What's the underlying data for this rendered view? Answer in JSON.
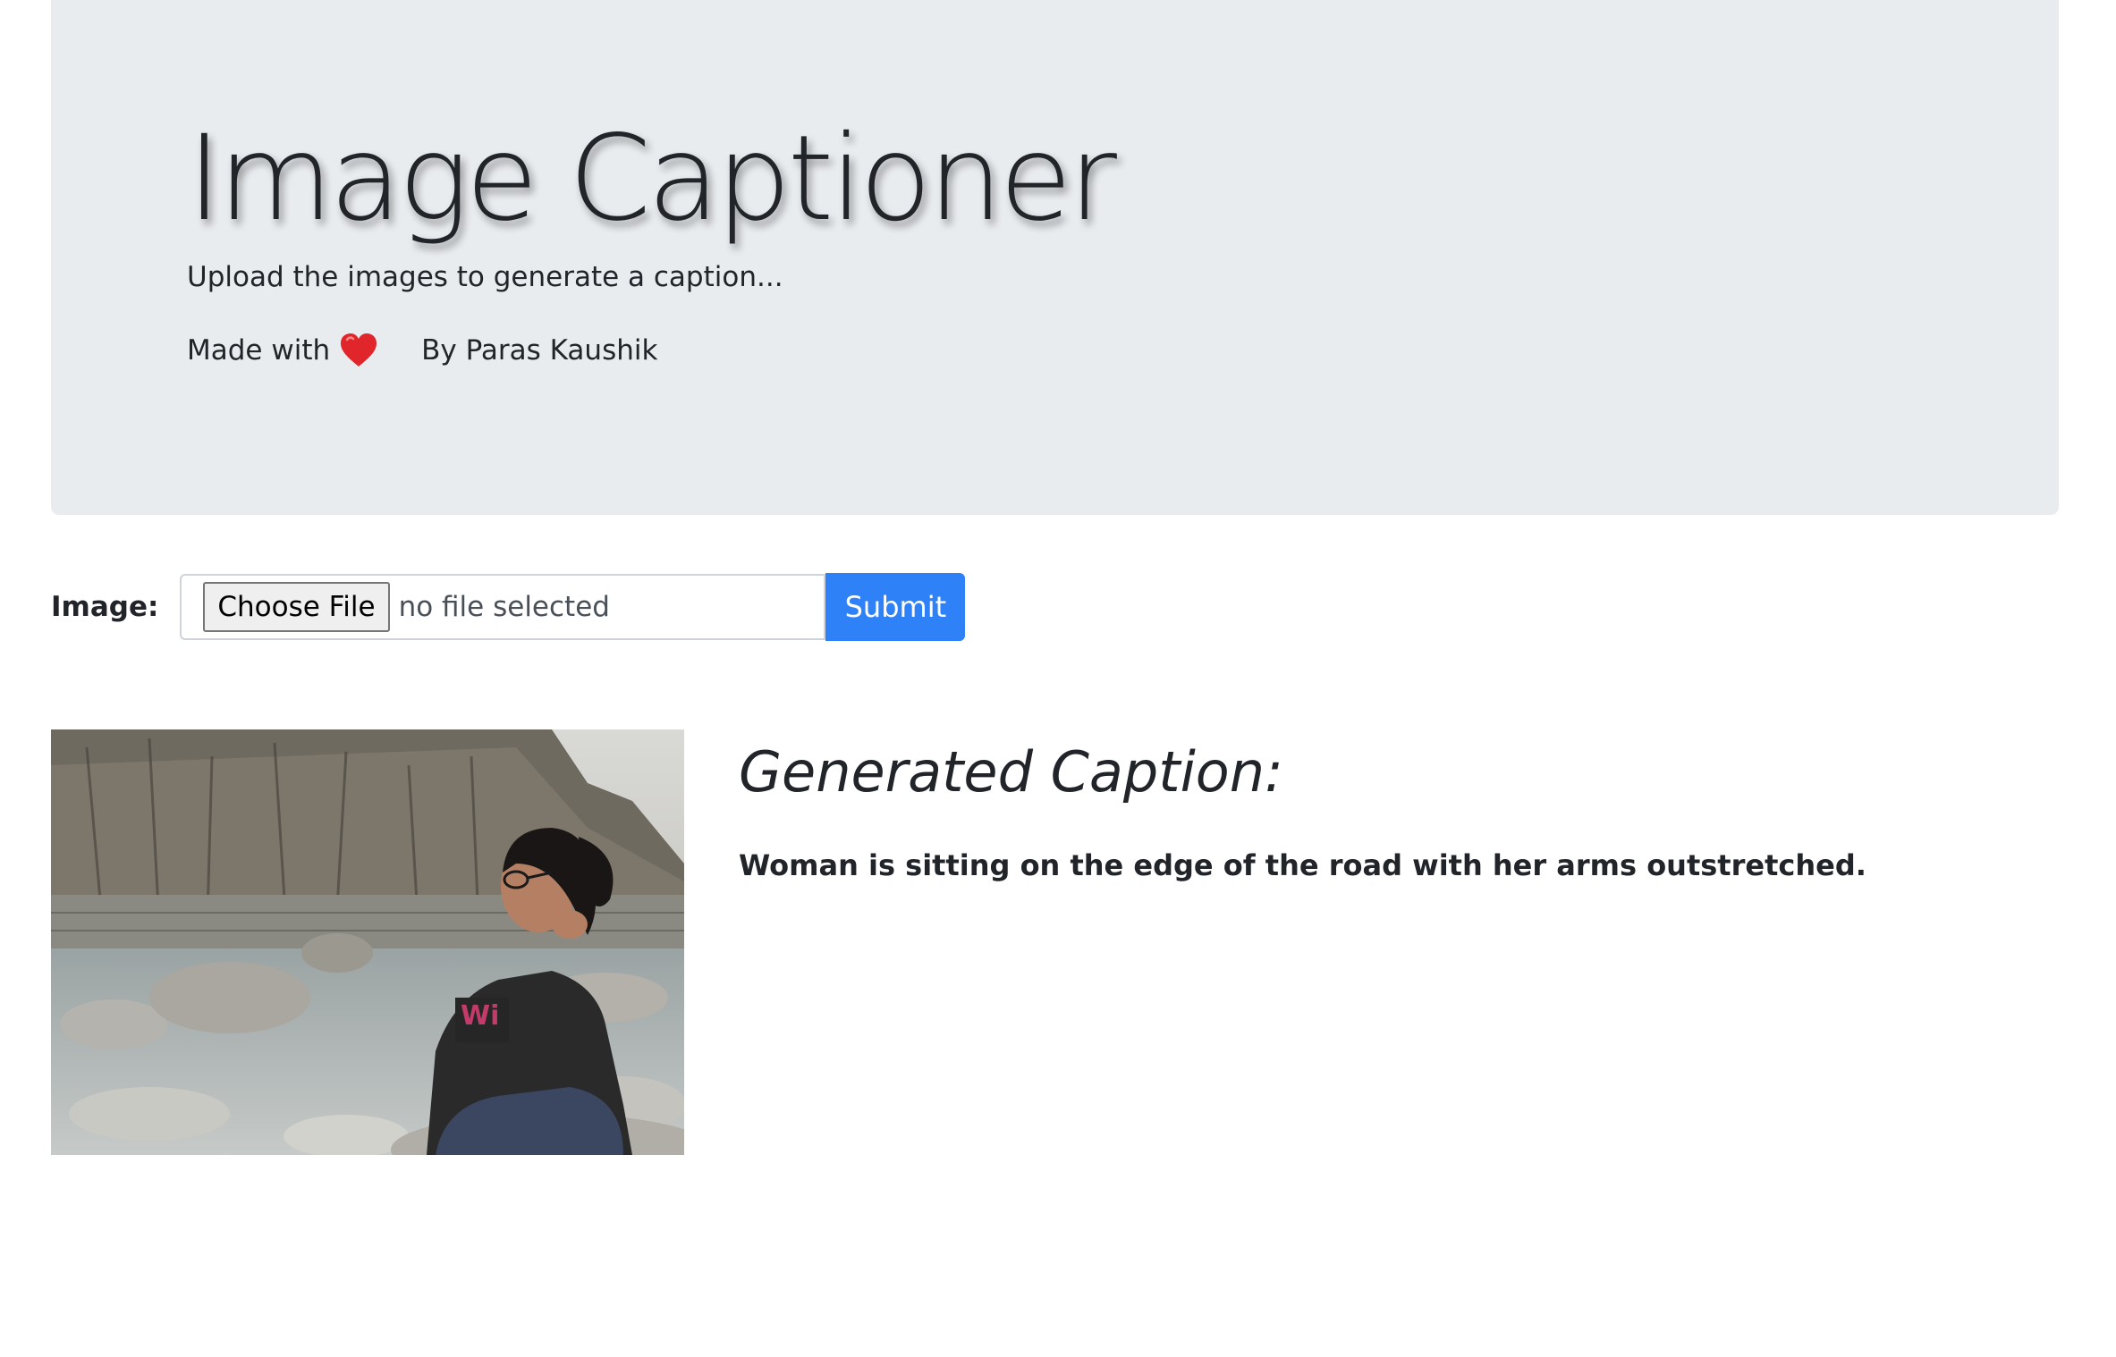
{
  "header": {
    "title": "Image Captioner",
    "subtitle": "Upload the images to generate a caption...",
    "made_with": "Made with",
    "heart_icon": "red-heart-icon",
    "author": "By Paras Kaushik"
  },
  "form": {
    "label": "Image:",
    "choose_file_label": "Choose File",
    "file_status": "no file selected",
    "submit_label": "Submit",
    "submit_color": "#2f81f7"
  },
  "result": {
    "photo_description_icon": "uploaded-photo",
    "heading": "Generated Caption:",
    "caption": "Woman is sitting on the edge of the road with her arms outstretched."
  }
}
